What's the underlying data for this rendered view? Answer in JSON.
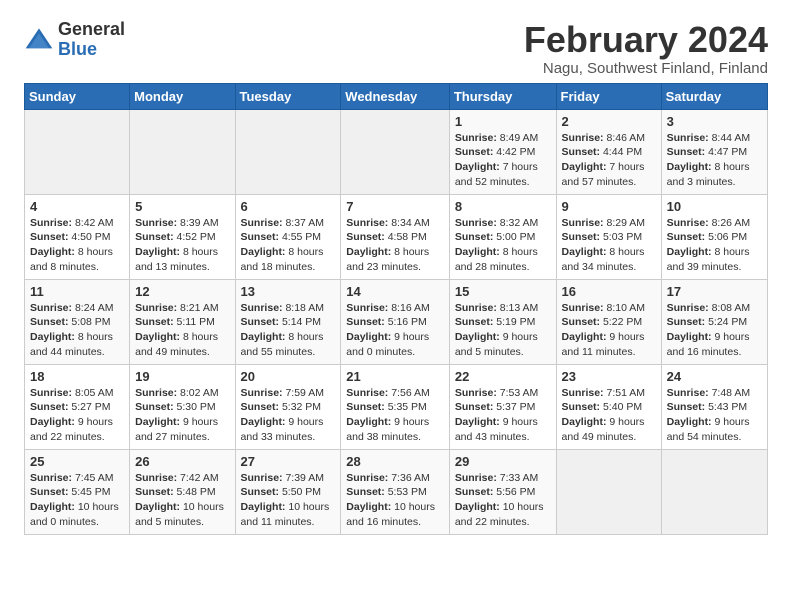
{
  "logo": {
    "general": "General",
    "blue": "Blue"
  },
  "title": "February 2024",
  "subtitle": "Nagu, Southwest Finland, Finland",
  "days_of_week": [
    "Sunday",
    "Monday",
    "Tuesday",
    "Wednesday",
    "Thursday",
    "Friday",
    "Saturday"
  ],
  "weeks": [
    [
      {
        "day": "",
        "info": ""
      },
      {
        "day": "",
        "info": ""
      },
      {
        "day": "",
        "info": ""
      },
      {
        "day": "",
        "info": ""
      },
      {
        "day": "1",
        "info": "Sunrise: 8:49 AM\nSunset: 4:42 PM\nDaylight: 7 hours and 52 minutes."
      },
      {
        "day": "2",
        "info": "Sunrise: 8:46 AM\nSunset: 4:44 PM\nDaylight: 7 hours and 57 minutes."
      },
      {
        "day": "3",
        "info": "Sunrise: 8:44 AM\nSunset: 4:47 PM\nDaylight: 8 hours and 3 minutes."
      }
    ],
    [
      {
        "day": "4",
        "info": "Sunrise: 8:42 AM\nSunset: 4:50 PM\nDaylight: 8 hours and 8 minutes."
      },
      {
        "day": "5",
        "info": "Sunrise: 8:39 AM\nSunset: 4:52 PM\nDaylight: 8 hours and 13 minutes."
      },
      {
        "day": "6",
        "info": "Sunrise: 8:37 AM\nSunset: 4:55 PM\nDaylight: 8 hours and 18 minutes."
      },
      {
        "day": "7",
        "info": "Sunrise: 8:34 AM\nSunset: 4:58 PM\nDaylight: 8 hours and 23 minutes."
      },
      {
        "day": "8",
        "info": "Sunrise: 8:32 AM\nSunset: 5:00 PM\nDaylight: 8 hours and 28 minutes."
      },
      {
        "day": "9",
        "info": "Sunrise: 8:29 AM\nSunset: 5:03 PM\nDaylight: 8 hours and 34 minutes."
      },
      {
        "day": "10",
        "info": "Sunrise: 8:26 AM\nSunset: 5:06 PM\nDaylight: 8 hours and 39 minutes."
      }
    ],
    [
      {
        "day": "11",
        "info": "Sunrise: 8:24 AM\nSunset: 5:08 PM\nDaylight: 8 hours and 44 minutes."
      },
      {
        "day": "12",
        "info": "Sunrise: 8:21 AM\nSunset: 5:11 PM\nDaylight: 8 hours and 49 minutes."
      },
      {
        "day": "13",
        "info": "Sunrise: 8:18 AM\nSunset: 5:14 PM\nDaylight: 8 hours and 55 minutes."
      },
      {
        "day": "14",
        "info": "Sunrise: 8:16 AM\nSunset: 5:16 PM\nDaylight: 9 hours and 0 minutes."
      },
      {
        "day": "15",
        "info": "Sunrise: 8:13 AM\nSunset: 5:19 PM\nDaylight: 9 hours and 5 minutes."
      },
      {
        "day": "16",
        "info": "Sunrise: 8:10 AM\nSunset: 5:22 PM\nDaylight: 9 hours and 11 minutes."
      },
      {
        "day": "17",
        "info": "Sunrise: 8:08 AM\nSunset: 5:24 PM\nDaylight: 9 hours and 16 minutes."
      }
    ],
    [
      {
        "day": "18",
        "info": "Sunrise: 8:05 AM\nSunset: 5:27 PM\nDaylight: 9 hours and 22 minutes."
      },
      {
        "day": "19",
        "info": "Sunrise: 8:02 AM\nSunset: 5:30 PM\nDaylight: 9 hours and 27 minutes."
      },
      {
        "day": "20",
        "info": "Sunrise: 7:59 AM\nSunset: 5:32 PM\nDaylight: 9 hours and 33 minutes."
      },
      {
        "day": "21",
        "info": "Sunrise: 7:56 AM\nSunset: 5:35 PM\nDaylight: 9 hours and 38 minutes."
      },
      {
        "day": "22",
        "info": "Sunrise: 7:53 AM\nSunset: 5:37 PM\nDaylight: 9 hours and 43 minutes."
      },
      {
        "day": "23",
        "info": "Sunrise: 7:51 AM\nSunset: 5:40 PM\nDaylight: 9 hours and 49 minutes."
      },
      {
        "day": "24",
        "info": "Sunrise: 7:48 AM\nSunset: 5:43 PM\nDaylight: 9 hours and 54 minutes."
      }
    ],
    [
      {
        "day": "25",
        "info": "Sunrise: 7:45 AM\nSunset: 5:45 PM\nDaylight: 10 hours and 0 minutes."
      },
      {
        "day": "26",
        "info": "Sunrise: 7:42 AM\nSunset: 5:48 PM\nDaylight: 10 hours and 5 minutes."
      },
      {
        "day": "27",
        "info": "Sunrise: 7:39 AM\nSunset: 5:50 PM\nDaylight: 10 hours and 11 minutes."
      },
      {
        "day": "28",
        "info": "Sunrise: 7:36 AM\nSunset: 5:53 PM\nDaylight: 10 hours and 16 minutes."
      },
      {
        "day": "29",
        "info": "Sunrise: 7:33 AM\nSunset: 5:56 PM\nDaylight: 10 hours and 22 minutes."
      },
      {
        "day": "",
        "info": ""
      },
      {
        "day": "",
        "info": ""
      }
    ]
  ]
}
